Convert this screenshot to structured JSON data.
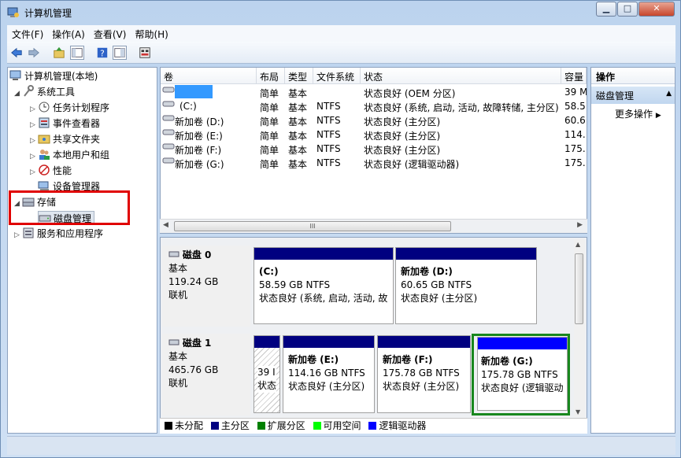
{
  "window": {
    "title": "计算机管理",
    "minimize": "▁",
    "maximize": "□",
    "close": "✕"
  },
  "menu": [
    "文件(F)",
    "操作(A)",
    "查看(V)",
    "帮助(H)"
  ],
  "toolbar": {
    "icons": [
      "back-arrow-icon",
      "forward-arrow-icon",
      "up-folder-icon",
      "show-hide-tree-icon",
      "help-icon",
      "properties-icon",
      "export-icon"
    ]
  },
  "tree": {
    "root": "计算机管理(本地)",
    "system_tools": "系统工具",
    "task_scheduler": "任务计划程序",
    "event_viewer": "事件查看器",
    "shared_folders": "共享文件夹",
    "local_users": "本地用户和组",
    "performance": "性能",
    "device_manager": "设备管理器",
    "storage": "存储",
    "disk_management": "磁盘管理",
    "services_apps": "服务和应用程序"
  },
  "table": {
    "headers": [
      "卷",
      "布局",
      "类型",
      "文件系统",
      "状态",
      "容量"
    ],
    "rows": [
      {
        "vol": "",
        "layout": "简单",
        "type": "基本",
        "fs": "",
        "status": "状态良好 (OEM 分区)",
        "cap": "39 M"
      },
      {
        "vol": "(C:)",
        "layout": "简单",
        "type": "基本",
        "fs": "NTFS",
        "status": "状态良好 (系统, 启动, 活动, 故障转储, 主分区)",
        "cap": "58.5"
      },
      {
        "vol": "新加卷 (D:)",
        "layout": "简单",
        "type": "基本",
        "fs": "NTFS",
        "status": "状态良好 (主分区)",
        "cap": "60.6"
      },
      {
        "vol": "新加卷 (E:)",
        "layout": "简单",
        "type": "基本",
        "fs": "NTFS",
        "status": "状态良好 (主分区)",
        "cap": "114."
      },
      {
        "vol": "新加卷 (F:)",
        "layout": "简单",
        "type": "基本",
        "fs": "NTFS",
        "status": "状态良好 (主分区)",
        "cap": "175."
      },
      {
        "vol": "新加卷 (G:)",
        "layout": "简单",
        "type": "基本",
        "fs": "NTFS",
        "status": "状态良好 (逻辑驱动器)",
        "cap": "175."
      }
    ],
    "scroll_grip": "III"
  },
  "disks": [
    {
      "name": "磁盘 0",
      "type": "基本",
      "size": "119.24 GB",
      "state": "联机"
    },
    {
      "name": "磁盘 1",
      "type": "基本",
      "size": "465.76 GB",
      "state": "联机"
    }
  ],
  "volumes": {
    "c": {
      "title": "(C:)",
      "size": "58.59 GB NTFS",
      "status": "状态良好 (系统, 启动, 活动, 故"
    },
    "d": {
      "title": "新加卷 (D:)",
      "size": "60.65 GB NTFS",
      "status": "状态良好 (主分区)"
    },
    "oem": {
      "size": "39 I",
      "status": "状态"
    },
    "e": {
      "title": "新加卷 (E:)",
      "size": "114.16 GB NTFS",
      "status": "状态良好 (主分区)"
    },
    "f": {
      "title": "新加卷 (F:)",
      "size": "175.78 GB NTFS",
      "status": "状态良好 (主分区)"
    },
    "g": {
      "title": "新加卷 (G:)",
      "size": "175.78 GB NTFS",
      "status": "状态良好 (逻辑驱动"
    }
  },
  "legend": [
    {
      "label": "未分配",
      "color": "#000000"
    },
    {
      "label": "主分区",
      "color": "#000080"
    },
    {
      "label": "扩展分区",
      "color": "#008000"
    },
    {
      "label": "可用空间",
      "color": "#00ff00"
    },
    {
      "label": "逻辑驱动器",
      "color": "#0000ff"
    }
  ],
  "actions": {
    "header": "操作",
    "selected": "磁盘管理",
    "more": "更多操作"
  },
  "colors": {
    "primary_bar": "#000080",
    "logical_bar": "#0000ff",
    "highlight_red": "#e00000",
    "highlight_green": "#18871e"
  }
}
